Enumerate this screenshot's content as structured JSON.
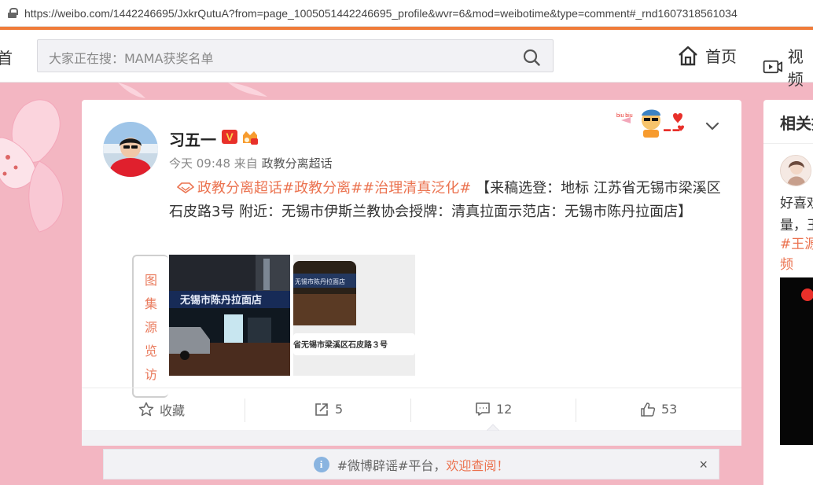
{
  "browser": {
    "url": "https://weibo.com/1442246695/JxkrQutuA?from=page_1005051442246695_profile&wvr=6&mod=weibotime&type=comment#_rnd1607318561034"
  },
  "header": {
    "logo_fragment": "首",
    "search_placeholder": "大家正在搜：MAMA获奖名单",
    "nav": [
      {
        "label": "首页",
        "icon": "home-icon"
      },
      {
        "label": "视频",
        "icon": "video-icon"
      }
    ]
  },
  "post": {
    "username": "习五一",
    "verified_badge": "V",
    "time": "今天 09:48",
    "source_prefix": "来自",
    "source": "政教分离超话",
    "hashtags": [
      "政教分离超话",
      "#政教分离#",
      "#治理清真泛化#"
    ],
    "text": "【来稿选登：地标 江苏省无锡市梁溪区石皮路3号 附近：无锡市伊斯兰教协会授牌：清真拉面示范店：无锡市陈丹拉面店】",
    "image1_sign": "无锡市陈丹拉面店",
    "image2_sign": "无锡市陈丹拉面店",
    "image2_caption": "省无锡市梁溪区石皮路３号",
    "gallery_chars": [
      "图",
      "集",
      "源",
      "览",
      "访"
    ],
    "actions": {
      "favorite_label": "收藏",
      "repost_count": "5",
      "comment_count": "12",
      "like_count": "53"
    }
  },
  "notice": {
    "text": "#微博辟谣#平台，",
    "link": "欢迎查阅！",
    "close": "×"
  },
  "sidebar": {
    "title": "相关推荐",
    "line1": "好喜欢",
    "line2": "量，王",
    "tag1": "#王源",
    "tag2": "频"
  },
  "colors": {
    "accent": "#eb7350",
    "background": "#f3b6c2",
    "url_underline": "#f07c3a"
  }
}
